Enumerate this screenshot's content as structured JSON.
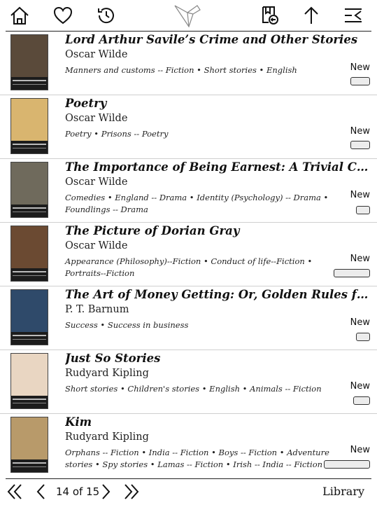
{
  "toolbar": {
    "icons": [
      "home-icon",
      "heart-icon",
      "history-icon",
      "bird-logo-icon",
      "book-return-icon",
      "sort-up-icon",
      "menu-icon"
    ]
  },
  "books": [
    {
      "title": "Lord Arthur Savile’s Crime and Other Stories",
      "author": "Oscar Wilde",
      "subjects": "Manners and customs -- Fiction • Short stories • English",
      "badge": "New",
      "progress": 0,
      "cover_color": "#5a4a3a"
    },
    {
      "title": "Poetry",
      "author": "Oscar Wilde",
      "subjects": "Poetry • Prisons -- Poetry",
      "badge": "New",
      "progress": 0,
      "cover_color": "#d9b56f"
    },
    {
      "title": "The Importance of Being Earnest: A Trivial Comedy for...",
      "author": "Oscar Wilde",
      "subjects": "Comedies • England -- Drama • Identity (Psychology) -- Drama • Foundlings -- Drama",
      "badge": "New",
      "progress": 0,
      "cover_color": "#6f6a5c"
    },
    {
      "title": "The Picture of Dorian Gray",
      "author": "Oscar Wilde",
      "subjects": "Appearance (Philosophy)--Fiction • Conduct of life--Fiction • Portraits--Fiction",
      "badge": "New",
      "progress": 0,
      "cover_color": "#6b4a32"
    },
    {
      "title": "The Art of Money Getting: Or, Golden Rules for Making...",
      "author": "P. T. Barnum",
      "subjects": "Success • Success in business",
      "badge": "New",
      "progress": 0,
      "cover_color": "#2f4a6a"
    },
    {
      "title": "Just So Stories",
      "author": "Rudyard Kipling",
      "subjects": "Short stories • Children's stories • English • Animals -- Fiction",
      "badge": "New",
      "progress": 0,
      "cover_color": "#e9d6c2"
    },
    {
      "title": "Kim",
      "author": "Rudyard Kipling",
      "subjects": "Orphans -- Fiction • India -- Fiction • Boys -- Fiction • Adventure stories • Spy stories • Lamas -- Fiction • Irish -- India -- Fiction",
      "badge": "New",
      "progress": 0,
      "cover_color": "#b89a6a"
    }
  ],
  "pagination": {
    "label": "14 of 15",
    "current": 14,
    "total": 15
  },
  "footer": {
    "library_label": "Library"
  }
}
